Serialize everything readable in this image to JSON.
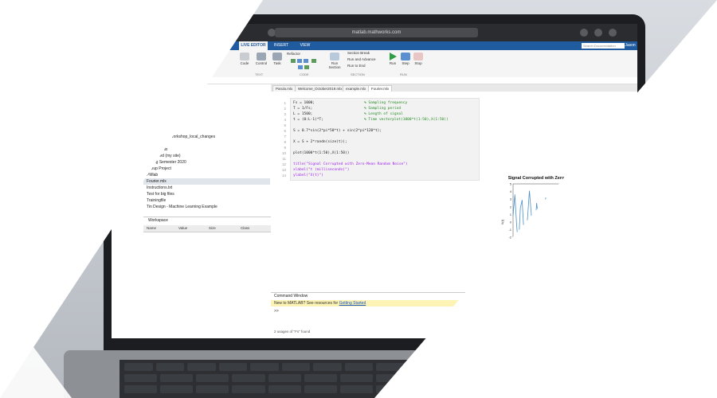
{
  "browser": {
    "url": "matlab.mathworks.com"
  },
  "toolstrip": {
    "tabs": [
      "LIVE EDITOR",
      "INSERT",
      "VIEW"
    ],
    "search_placeholder": "Search Documentation",
    "user": "Jason",
    "buttons": {
      "code": "Code",
      "control": "Control",
      "task": "Task",
      "refactor": "Refactor",
      "section_break": "Section Break",
      "run_and_advance": "Run and Advance",
      "run_to_end": "Run to End",
      "run_section": "Run Section",
      "run": "Run",
      "step": "Step",
      "stop": "Stop"
    },
    "groups": [
      "TEXT",
      "CODE",
      "SECTION",
      "RUN"
    ],
    "path": "Drive"
  },
  "file_browser": {
    "items": [
      {
        "label": "und Support Packages"
      },
      {
        "label": "Project"
      },
      {
        "label": "ineLearning_Workshop_local_changes"
      },
      {
        "label": "ands"
      },
      {
        "label": "Parula2.mlx"
      },
      {
        "label": "Published (my site)"
      },
      {
        "label": "Spring Semester 2020"
      },
      {
        "label": "Group Project"
      },
      {
        "label": "PMlab"
      },
      {
        "label": "Fourier.mlx"
      },
      {
        "label": "Instructions.txt"
      },
      {
        "label": "Test for big files"
      },
      {
        "label": "Trainingfile"
      },
      {
        "label": "Tin Design - Machine Learning Example"
      }
    ],
    "selected": "Fourier.mlx"
  },
  "workspace": {
    "title": "Workspace",
    "columns": [
      "Name",
      "Value",
      "Size",
      "Class"
    ]
  },
  "editor": {
    "tabs": [
      "Parula.mlx",
      "Welcome_October2019.mlx",
      "example.mlx",
      "Fourier.mlx"
    ],
    "active_tab": "Fourier.mlx",
    "lines": [
      {
        "n": "1",
        "code": "Fs = 1000;",
        "comment": "% Sampling frequency"
      },
      {
        "n": "2",
        "code": "T = 1/Fs;",
        "comment": "% Sampling period"
      },
      {
        "n": "3",
        "code": "L = 1500;",
        "comment": "% Length of signal"
      },
      {
        "n": "4",
        "code": "t = (0:L-1)*T;",
        "comment": "% Time vectorplot(1000*t(1:50),X(1:50))"
      },
      {
        "n": "5",
        "code": "",
        "comment": ""
      },
      {
        "n": "6",
        "code": "S = 0.7*sin(2*pi*50*t) + sin(2*pi*120*t);",
        "comment": ""
      },
      {
        "n": "7",
        "code": "",
        "comment": ""
      },
      {
        "n": "8",
        "code": "X = S + 2*randn(size(t));",
        "comment": ""
      },
      {
        "n": "9",
        "code": "",
        "comment": ""
      },
      {
        "n": "10",
        "code": "plot(1000*t(1:50),X(1:50))",
        "comment": ""
      },
      {
        "n": "11",
        "code": "",
        "comment": ""
      },
      {
        "n": "12",
        "code": "title(\"Signal Corrupted with Zero-Mean Random Noise\")",
        "comment": ""
      },
      {
        "n": "13",
        "code": "xlabel(\"t (milliseconds)\")",
        "comment": ""
      },
      {
        "n": "14",
        "code": "ylabel(\"X(t)\")",
        "comment": ""
      }
    ]
  },
  "chart_data": {
    "type": "line",
    "title": "Signal Corrupted with Zero-Mean Random Noise",
    "xlabel": "t (millisec)",
    "ylabel": "X(t)",
    "xlim": [
      0,
      50
    ],
    "ylim": [
      -5,
      5
    ],
    "xticks": [
      0,
      10,
      20,
      30,
      40,
      50
    ],
    "yticks": [
      -4,
      -3,
      -2,
      -1,
      0,
      1,
      2,
      3,
      4,
      5
    ],
    "series": [
      {
        "color": "#4a90c8",
        "x": [
          0,
          1,
          2,
          3,
          4,
          5,
          6,
          7,
          8,
          9,
          10,
          11,
          12,
          13,
          14,
          15,
          16,
          17,
          18,
          19,
          20,
          21,
          22,
          23,
          24,
          25,
          26,
          27,
          28,
          29,
          30,
          31,
          32,
          33,
          34,
          35,
          36,
          37,
          38,
          39,
          40,
          41,
          42,
          43,
          44,
          45,
          46,
          47,
          48,
          49
        ],
        "y": [
          0.8,
          3.6,
          -0.5,
          -3.2,
          1.8,
          2.9,
          -1.5,
          -2.1,
          0.6,
          4.1,
          1.2,
          -3.8,
          -1.0,
          2.5,
          0.3,
          -4.2,
          -2.0,
          1.5,
          3.2,
          -0.8,
          -2.9,
          0.4,
          2.2,
          -1.6,
          -3.0,
          1.1,
          2.8,
          0.2,
          -2.4,
          -0.5,
          3.5,
          1.9,
          -1.8,
          -3.4,
          0.7,
          2.6,
          -0.3,
          -2.2,
          1.4,
          3.0,
          -1.2,
          -2.6,
          0.9,
          2.1,
          -1.9,
          -0.6,
          1.7,
          3.3,
          -0.4,
          -1.5
        ]
      }
    ]
  },
  "command_window": {
    "title": "Command Window",
    "notice": "New to MATLAB? See resources for ",
    "link": "Getting Started",
    "prompt": ">>"
  },
  "status": {
    "text": "2 usages of \"Fs\" found"
  }
}
